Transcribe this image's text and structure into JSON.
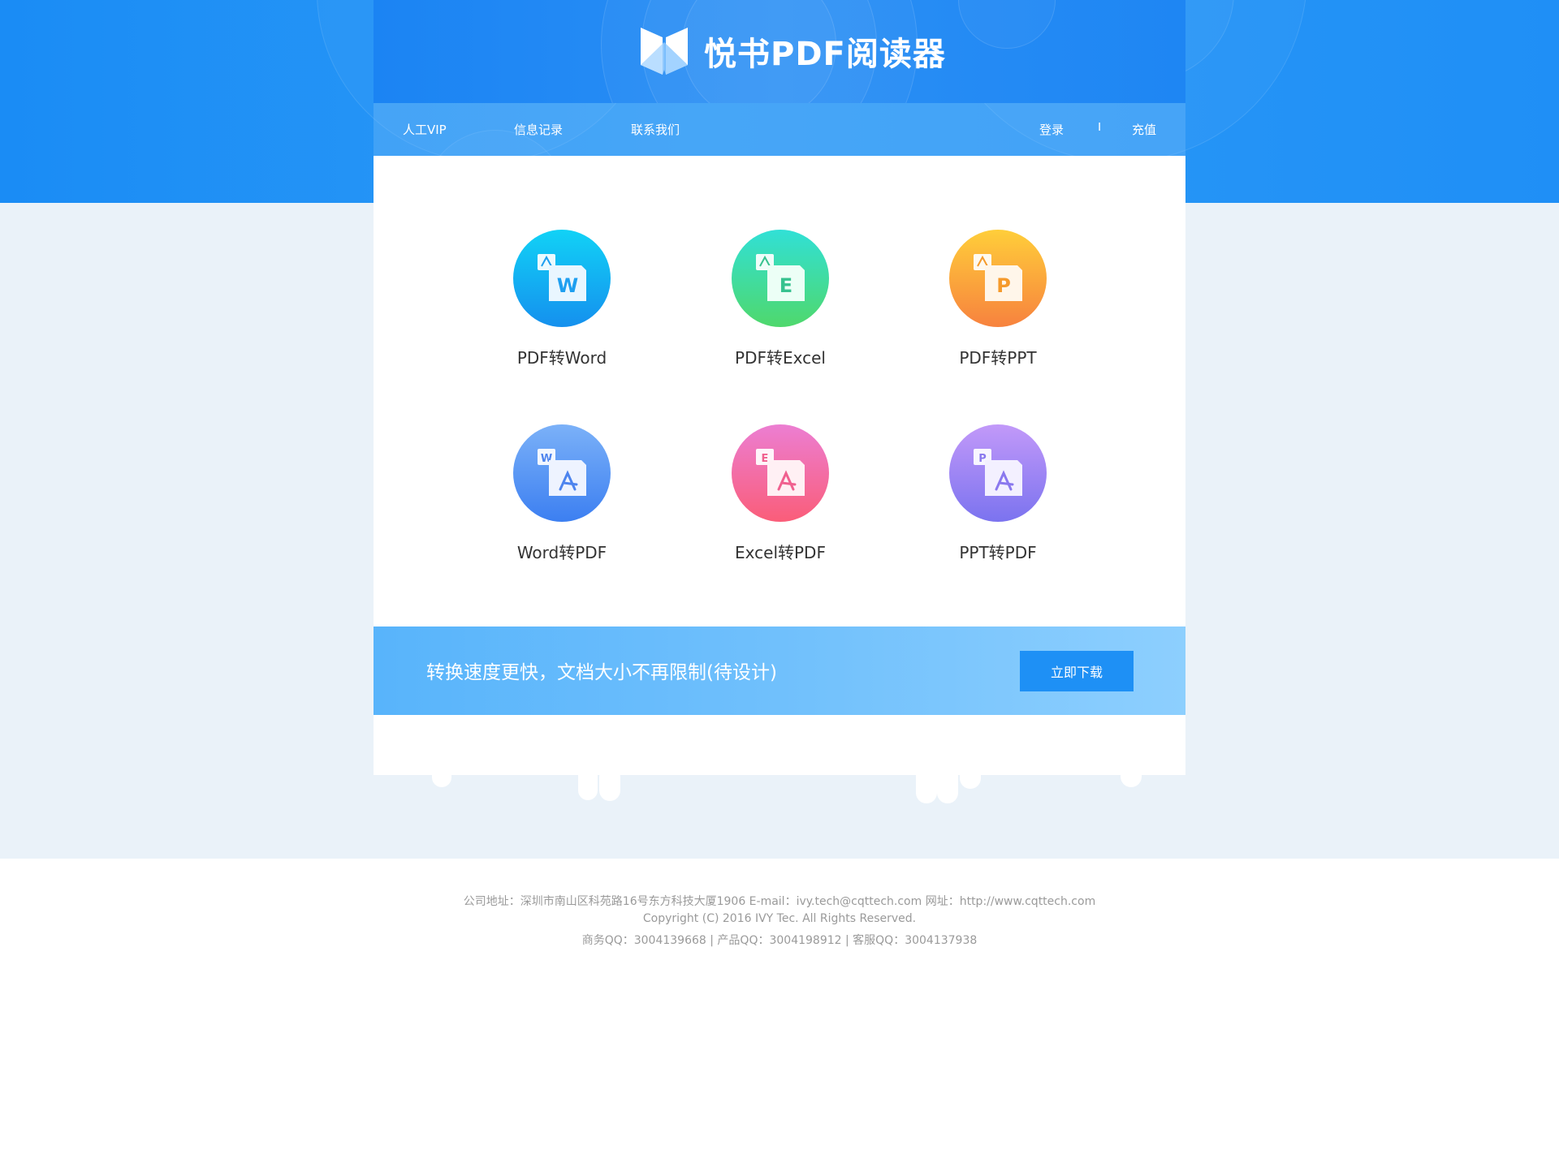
{
  "brand": {
    "name": "悦书PDF阅读器"
  },
  "nav": {
    "left": [
      "人工VIP",
      "信息记录",
      "联系我们"
    ],
    "login": "登录",
    "separator": "I",
    "recharge": "充值"
  },
  "tools": [
    {
      "label": "PDF转Word",
      "badge": "W",
      "icon": "pdf-to-word-icon",
      "colors": [
        "#11d2f6",
        "#1590ee"
      ],
      "accent": "#1e9ff0"
    },
    {
      "label": "PDF转Excel",
      "badge": "E",
      "icon": "pdf-to-excel-icon",
      "colors": [
        "#31e0d6",
        "#4fd86c"
      ],
      "accent": "#37c28f"
    },
    {
      "label": "PDF转PPT",
      "badge": "P",
      "icon": "pdf-to-ppt-icon",
      "colors": [
        "#ffce3a",
        "#f7823e"
      ],
      "accent": "#f59a2c"
    },
    {
      "label": "Word转PDF",
      "badge": "W",
      "icon": "word-to-pdf-icon",
      "colors": [
        "#7bb1f8",
        "#3c7ff1"
      ],
      "accent": "#4d84ee"
    },
    {
      "label": "Excel转PDF",
      "badge": "E",
      "icon": "excel-to-pdf-icon",
      "colors": [
        "#ec7ed2",
        "#fa5d79"
      ],
      "accent": "#f0608f"
    },
    {
      "label": "PPT转PDF",
      "badge": "P",
      "icon": "ppt-to-pdf-icon",
      "colors": [
        "#c299f9",
        "#7b73ef"
      ],
      "accent": "#8a78ee"
    }
  ],
  "promo": {
    "text": "转换速度更快，文档大小不再限制(待设计)",
    "button": "立即下载"
  },
  "footer": {
    "line1": "公司地址：深圳市南山区科苑路16号东方科技大厦1906    E-mail：ivy.tech@cqttech.com    网址：http://www.cqttech.com",
    "line2": "Copyright (C) 2016 IVY Tec. All Rights Reserved.",
    "line3": "商务QQ：3004139668 | 产品QQ：3004198912 | 客服QQ：3004137938"
  },
  "theme": {
    "primary": "#1e90f5",
    "light_bg": "#eaf2f9",
    "promo_gradient": [
      "#58b4fb",
      "#8dcffe"
    ]
  }
}
